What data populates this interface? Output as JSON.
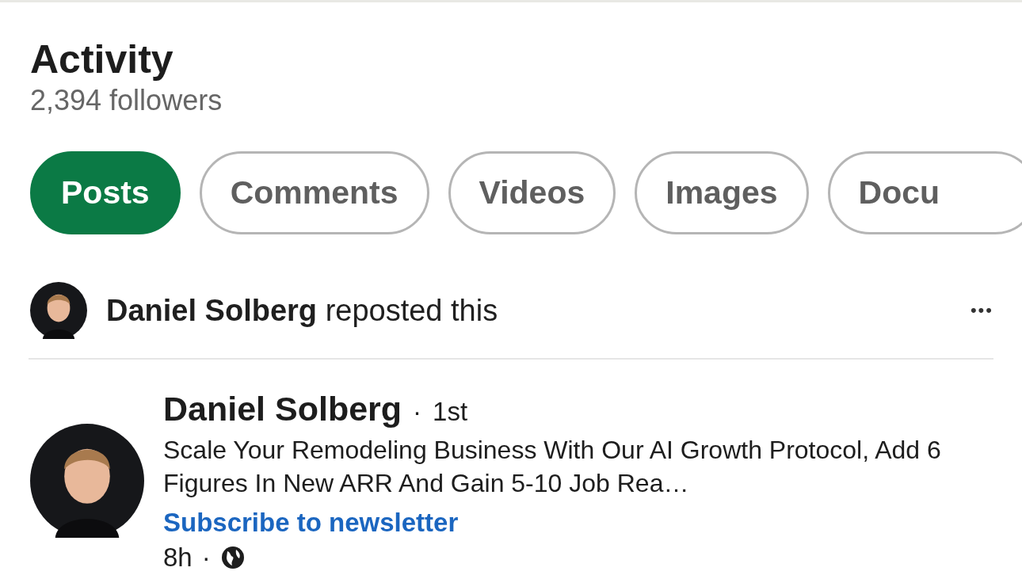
{
  "header": {
    "title": "Activity",
    "followers": "2,394 followers"
  },
  "tabs": [
    {
      "label": "Posts",
      "selected": true
    },
    {
      "label": "Comments",
      "selected": false
    },
    {
      "label": "Videos",
      "selected": false
    },
    {
      "label": "Images",
      "selected": false
    },
    {
      "label": "Docu",
      "selected": false
    }
  ],
  "repost": {
    "name": "Daniel Solberg",
    "action": "reposted this",
    "menu": "•••"
  },
  "post": {
    "author": "Daniel Solberg",
    "separator": "·",
    "degree": "1st",
    "headline": "Scale Your Remodeling Business With Our AI Growth Protocol, Add 6 Figures In New ARR And Gain 5-10 Job Rea…",
    "link": "Subscribe to newsletter",
    "time": "8h",
    "time_separator": "·"
  }
}
